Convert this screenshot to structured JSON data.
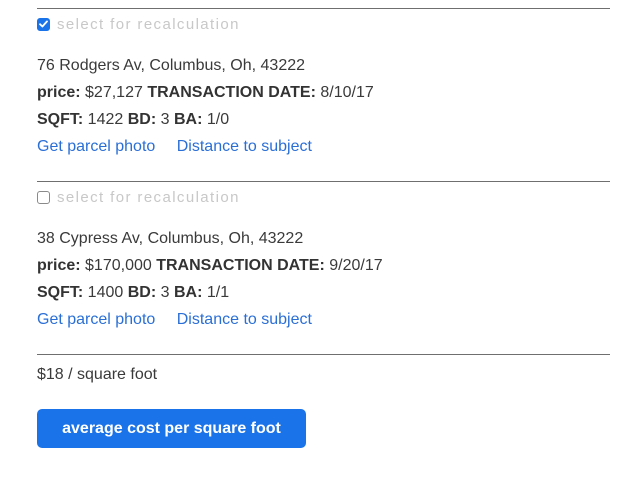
{
  "select_label": "select for recalculation",
  "labels": {
    "price": "price:",
    "transaction_date": "TRANSACTION DATE:",
    "sqft": "SQFT:",
    "bd": "BD:",
    "ba": "BA:"
  },
  "properties": [
    {
      "selected": true,
      "address": "76 Rodgers Av, Columbus, Oh, 43222",
      "price": "$27,127",
      "transaction_date": "8/10/17",
      "sqft": "1422",
      "bd": "3",
      "ba": "1/0",
      "photo_link": "Get parcel photo",
      "distance_link": "Distance to subject"
    },
    {
      "selected": false,
      "address": "38 Cypress Av, Columbus, Oh, 43222",
      "price": "$170,000",
      "transaction_date": "9/20/17",
      "sqft": "1400",
      "bd": "3",
      "ba": "1/1",
      "photo_link": "Get parcel photo",
      "distance_link": "Distance to subject"
    }
  ],
  "summary": "$18 / square foot",
  "button_label": "average cost per square foot",
  "colors": {
    "accent": "#1a73e8",
    "link": "#2a6fd6",
    "muted_label": "#c8c8c8",
    "divider": "#6f6f6f"
  }
}
